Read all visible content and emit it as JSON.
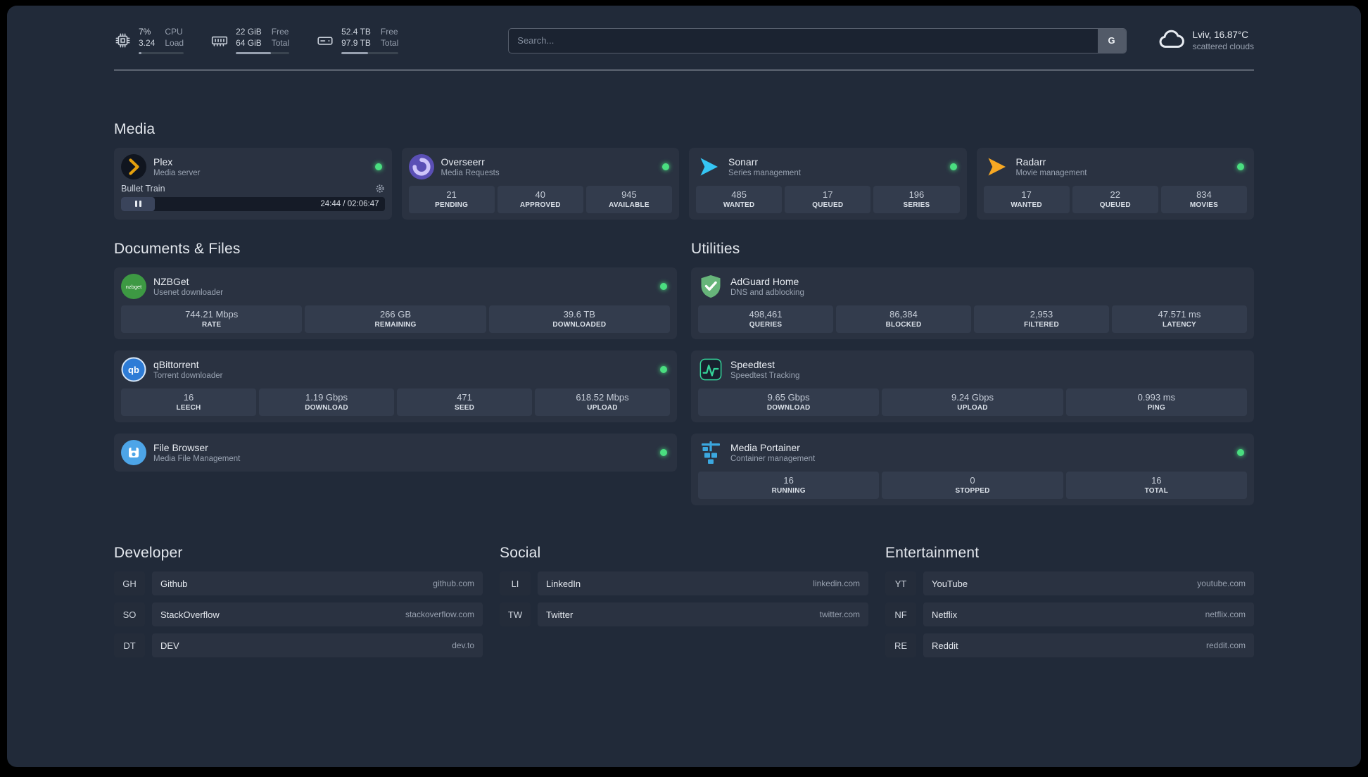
{
  "topbar": {
    "cpu": {
      "line1": "7%",
      "line2": "3.24",
      "label1": "CPU",
      "label2": "Load",
      "progress": 7
    },
    "memory": {
      "line1": "22 GiB",
      "line2": "64 GiB",
      "label1": "Free",
      "label2": "Total",
      "progress": 66
    },
    "disk": {
      "line1": "52.4 TB",
      "line2": "97.9 TB",
      "label1": "Free",
      "label2": "Total",
      "progress": 47
    },
    "search": {
      "placeholder": "Search...",
      "provider_label": "G"
    },
    "weather": {
      "location": "Lviv, 16.87°C",
      "condition": "scattered clouds"
    }
  },
  "sections": {
    "media": {
      "title": "Media",
      "services": [
        {
          "name": "Plex",
          "subtitle": "Media server",
          "icon": "plex-icon",
          "status": "online",
          "player": {
            "track": "Bullet Train",
            "time": "24:44 / 02:06:47"
          }
        },
        {
          "name": "Overseerr",
          "subtitle": "Media Requests",
          "icon": "overseerr-icon",
          "status": "online",
          "stats": [
            {
              "value": "21",
              "label": "PENDING"
            },
            {
              "value": "40",
              "label": "APPROVED"
            },
            {
              "value": "945",
              "label": "AVAILABLE"
            }
          ]
        },
        {
          "name": "Sonarr",
          "subtitle": "Series management",
          "icon": "sonarr-icon",
          "status": "online",
          "stats": [
            {
              "value": "485",
              "label": "WANTED"
            },
            {
              "value": "17",
              "label": "QUEUED"
            },
            {
              "value": "196",
              "label": "SERIES"
            }
          ]
        },
        {
          "name": "Radarr",
          "subtitle": "Movie management",
          "icon": "radarr-icon",
          "status": "online",
          "stats": [
            {
              "value": "17",
              "label": "WANTED"
            },
            {
              "value": "22",
              "label": "QUEUED"
            },
            {
              "value": "834",
              "label": "MOVIES"
            }
          ]
        }
      ]
    },
    "documents": {
      "title": "Documents & Files",
      "services": [
        {
          "name": "NZBGet",
          "subtitle": "Usenet downloader",
          "icon": "nzbget-icon",
          "status": "online",
          "stats": [
            {
              "value": "744.21 Mbps",
              "label": "RATE"
            },
            {
              "value": "266 GB",
              "label": "REMAINING"
            },
            {
              "value": "39.6 TB",
              "label": "DOWNLOADED"
            }
          ]
        },
        {
          "name": "qBittorrent",
          "subtitle": "Torrent downloader",
          "icon": "qbittorrent-icon",
          "status": "online",
          "stats": [
            {
              "value": "16",
              "label": "LEECH"
            },
            {
              "value": "1.19 Gbps",
              "label": "DOWNLOAD"
            },
            {
              "value": "471",
              "label": "SEED"
            },
            {
              "value": "618.52 Mbps",
              "label": "UPLOAD"
            }
          ]
        },
        {
          "name": "File Browser",
          "subtitle": "Media File Management",
          "icon": "filebrowser-icon",
          "status": "online",
          "stats": []
        }
      ]
    },
    "utilities": {
      "title": "Utilities",
      "services": [
        {
          "name": "AdGuard Home",
          "subtitle": "DNS and adblocking",
          "icon": "adguard-icon",
          "status": "none",
          "stats": [
            {
              "value": "498,461",
              "label": "QUERIES"
            },
            {
              "value": "86,384",
              "label": "BLOCKED"
            },
            {
              "value": "2,953",
              "label": "FILTERED"
            },
            {
              "value": "47.571 ms",
              "label": "LATENCY"
            }
          ]
        },
        {
          "name": "Speedtest",
          "subtitle": "Speedtest Tracking",
          "icon": "speedtest-icon",
          "status": "none",
          "stats": [
            {
              "value": "9.65 Gbps",
              "label": "DOWNLOAD"
            },
            {
              "value": "9.24 Gbps",
              "label": "UPLOAD"
            },
            {
              "value": "0.993 ms",
              "label": "PING"
            }
          ]
        },
        {
          "name": "Media Portainer",
          "subtitle": "Container management",
          "icon": "portainer-icon",
          "status": "online",
          "stats": [
            {
              "value": "16",
              "label": "RUNNING"
            },
            {
              "value": "0",
              "label": "STOPPED"
            },
            {
              "value": "16",
              "label": "TOTAL"
            }
          ]
        }
      ]
    }
  },
  "bookmarks": [
    {
      "title": "Developer",
      "items": [
        {
          "abbr": "GH",
          "name": "Github",
          "url": "github.com"
        },
        {
          "abbr": "SO",
          "name": "StackOverflow",
          "url": "stackoverflow.com"
        },
        {
          "abbr": "DT",
          "name": "DEV",
          "url": "dev.to"
        }
      ]
    },
    {
      "title": "Social",
      "items": [
        {
          "abbr": "LI",
          "name": "LinkedIn",
          "url": "linkedin.com"
        },
        {
          "abbr": "TW",
          "name": "Twitter",
          "url": "twitter.com"
        }
      ]
    },
    {
      "title": "Entertainment",
      "items": [
        {
          "abbr": "YT",
          "name": "YouTube",
          "url": "youtube.com"
        },
        {
          "abbr": "NF",
          "name": "Netflix",
          "url": "netflix.com"
        },
        {
          "abbr": "RE",
          "name": "Reddit",
          "url": "reddit.com"
        }
      ]
    }
  ],
  "colors": {
    "status_online": "#4ade80",
    "plex": "#e5a00d",
    "overseerr": "#5a4fb5",
    "sonarr": "#35c5f4",
    "radarr": "#f7a823",
    "nzbget": "#3d9943",
    "qbittorrent": "#2e7cd6",
    "filebrowser": "#4da5e8",
    "adguard": "#67b57a",
    "speedtest": "#34d399",
    "portainer": "#3ba8e0"
  }
}
